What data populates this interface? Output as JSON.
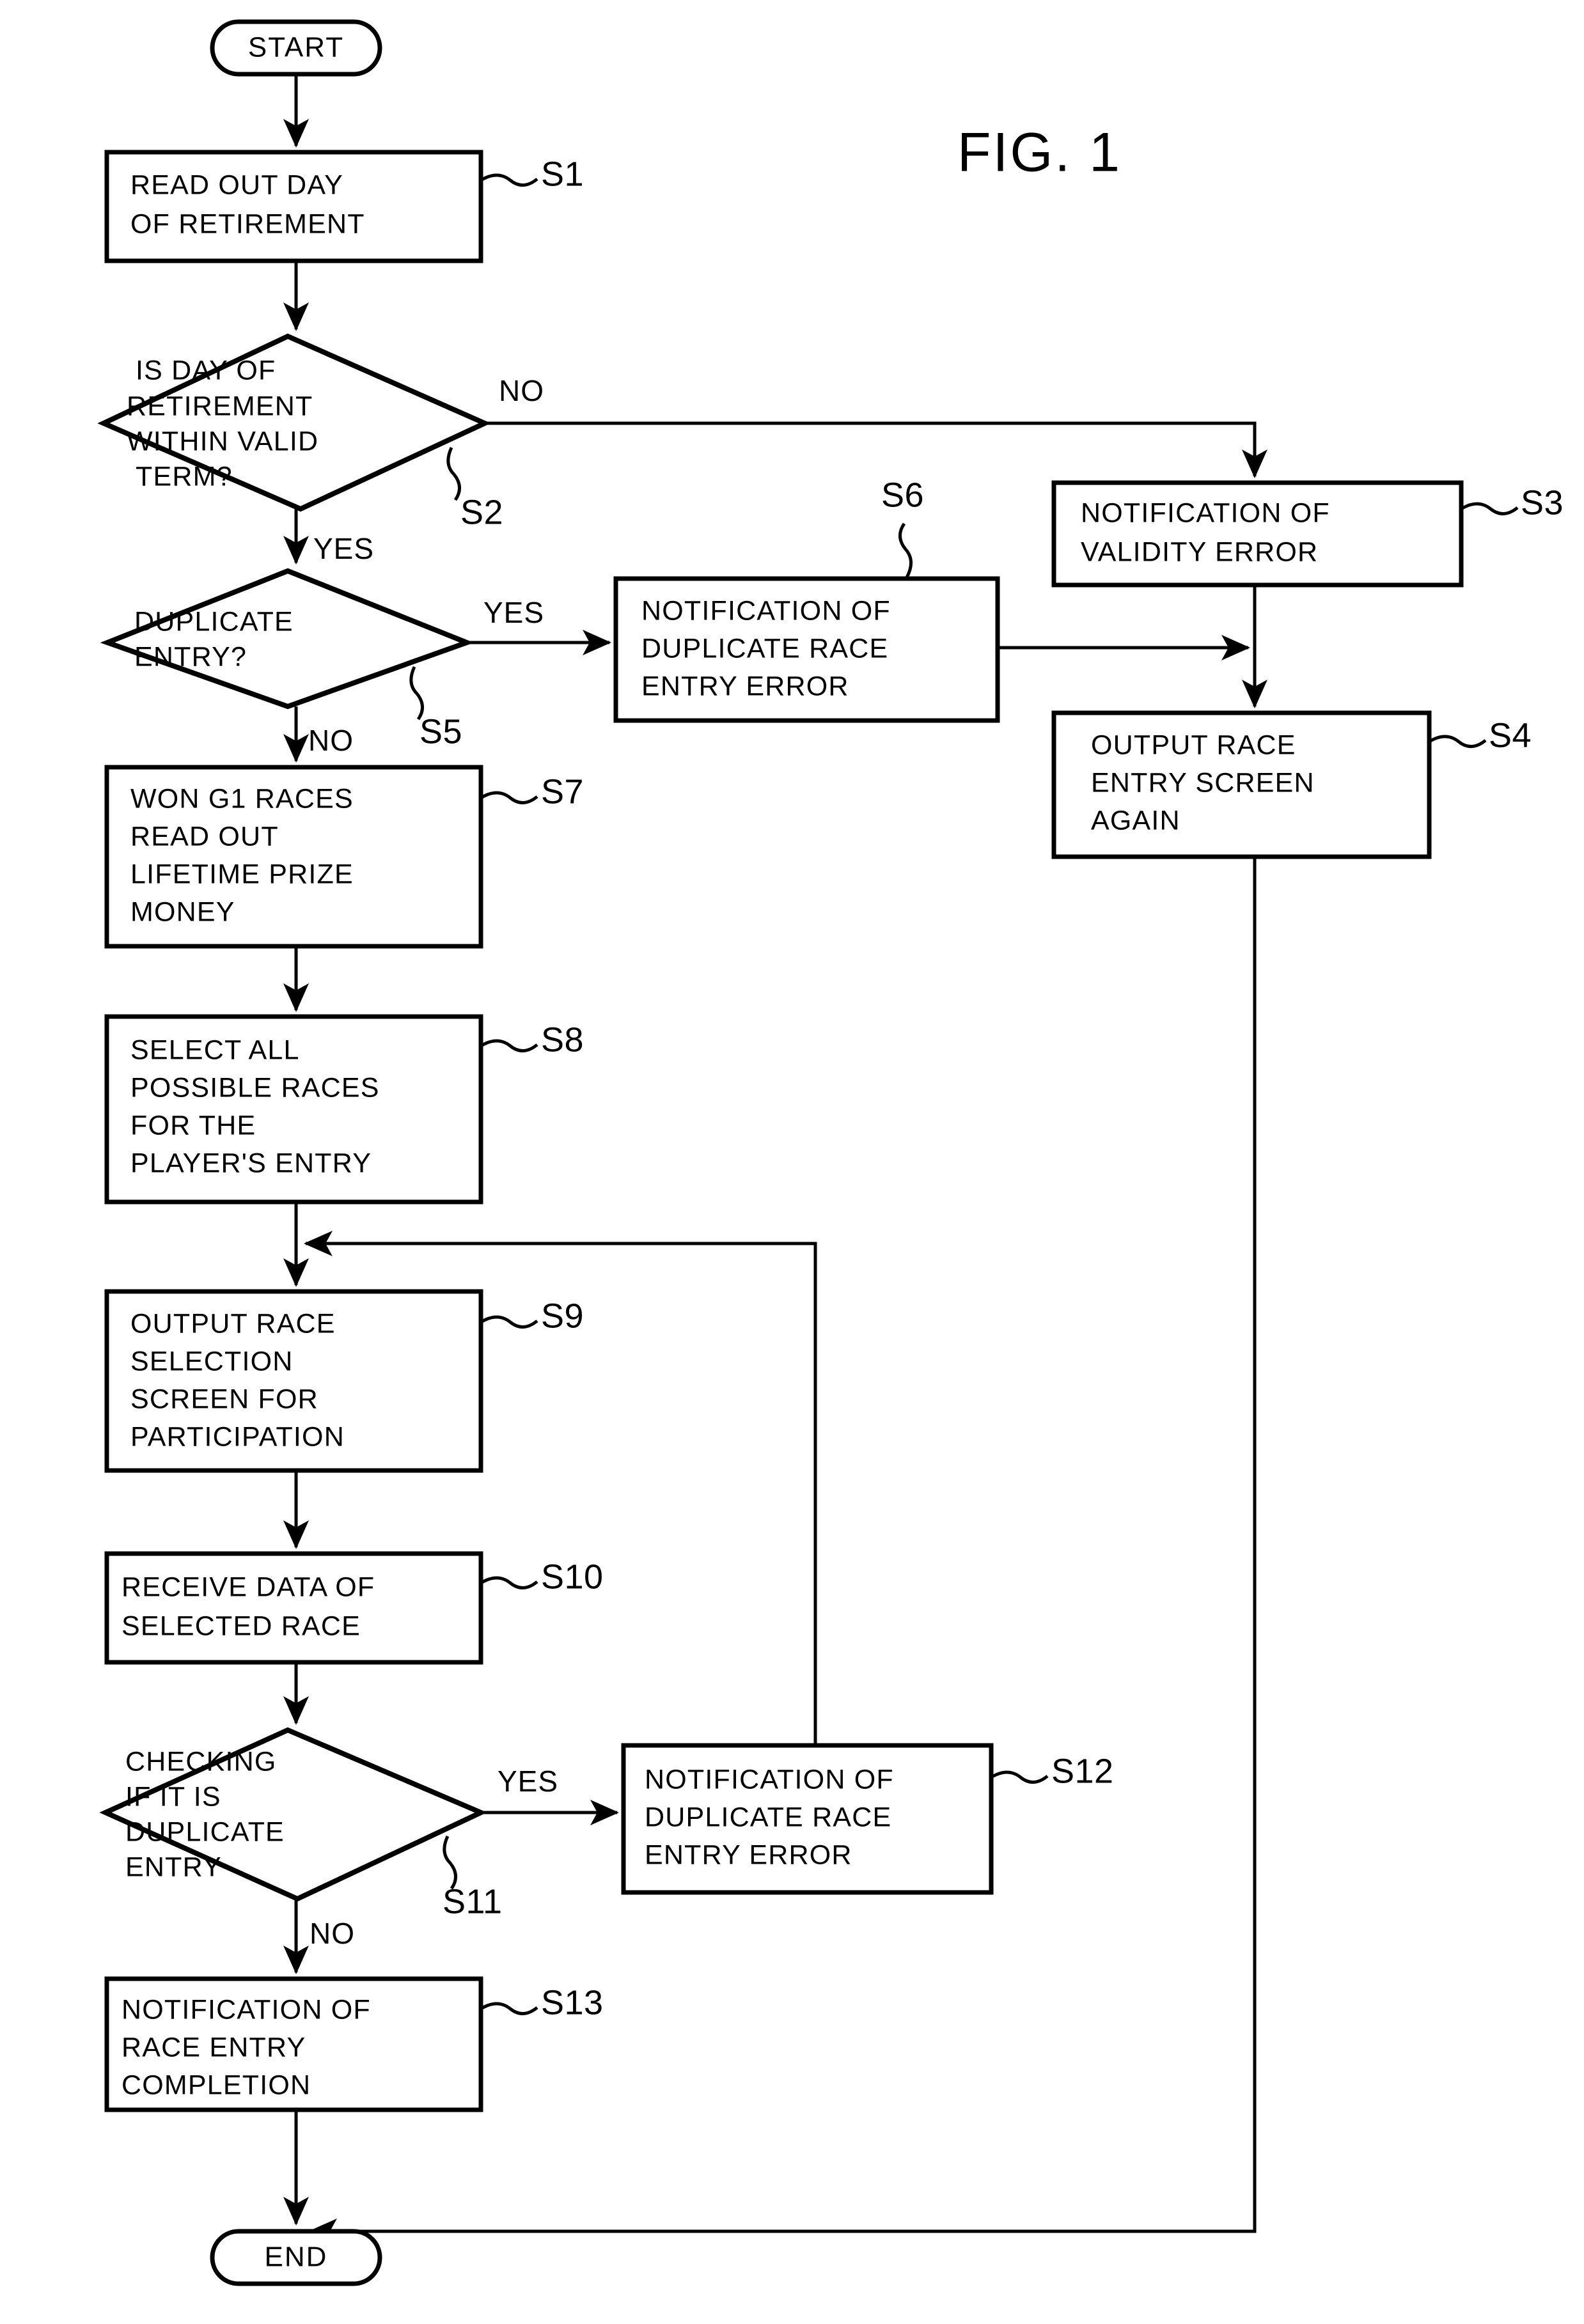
{
  "figure": {
    "title": "FIG. 1",
    "type": "flowchart"
  },
  "terminals": {
    "start": "START",
    "end": "END"
  },
  "steps": [
    {
      "id": "S1",
      "label": "S1",
      "shape": "process",
      "lines": [
        "READ OUT DAY",
        "OF RETIREMENT"
      ]
    },
    {
      "id": "S2",
      "label": "S2",
      "shape": "decision",
      "lines": [
        "IS DAY OF",
        "RETIREMENT",
        "WITHIN VALID",
        "TERM?"
      ]
    },
    {
      "id": "S3",
      "label": "S3",
      "shape": "process",
      "lines": [
        "NOTIFICATION OF",
        "VALIDITY ERROR"
      ]
    },
    {
      "id": "S4",
      "label": "S4",
      "shape": "process",
      "lines": [
        "OUTPUT RACE",
        "ENTRY SCREEN",
        "AGAIN"
      ]
    },
    {
      "id": "S5",
      "label": "S5",
      "shape": "decision",
      "lines": [
        "DUPLICATE",
        "ENTRY?"
      ]
    },
    {
      "id": "S6",
      "label": "S6",
      "shape": "process",
      "lines": [
        "NOTIFICATION OF",
        "DUPLICATE RACE",
        "ENTRY ERROR"
      ]
    },
    {
      "id": "S7",
      "label": "S7",
      "shape": "process",
      "lines": [
        "WON G1 RACES",
        "READ OUT",
        "LIFETIME PRIZE",
        "MONEY"
      ]
    },
    {
      "id": "S8",
      "label": "S8",
      "shape": "process",
      "lines": [
        "SELECT ALL",
        "POSSIBLE RACES",
        "FOR THE",
        "PLAYER'S ENTRY"
      ]
    },
    {
      "id": "S9",
      "label": "S9",
      "shape": "process",
      "lines": [
        "OUTPUT RACE",
        "SELECTION",
        "SCREEN FOR",
        "PARTICIPATION"
      ]
    },
    {
      "id": "S10",
      "label": "S10",
      "shape": "process",
      "lines": [
        "RECEIVE DATA OF",
        "SELECTED RACE"
      ]
    },
    {
      "id": "S11",
      "label": "S11",
      "shape": "decision",
      "lines": [
        "CHECKING",
        "IF IT IS",
        "DUPLICATE",
        "ENTRY"
      ]
    },
    {
      "id": "S12",
      "label": "S12",
      "shape": "process",
      "lines": [
        "NOTIFICATION OF",
        "DUPLICATE RACE",
        "ENTRY ERROR"
      ]
    },
    {
      "id": "S13",
      "label": "S13",
      "shape": "process",
      "lines": [
        "NOTIFICATION OF",
        "RACE ENTRY",
        "COMPLETION"
      ]
    }
  ],
  "branch_labels": {
    "s2_no": "NO",
    "s2_yes": "YES",
    "s5_yes": "YES",
    "s5_no": "NO",
    "s11_yes": "YES",
    "s11_no": "NO"
  },
  "colors": {
    "stroke": "#000000",
    "fill": "#ffffff",
    "text": "#000000"
  }
}
